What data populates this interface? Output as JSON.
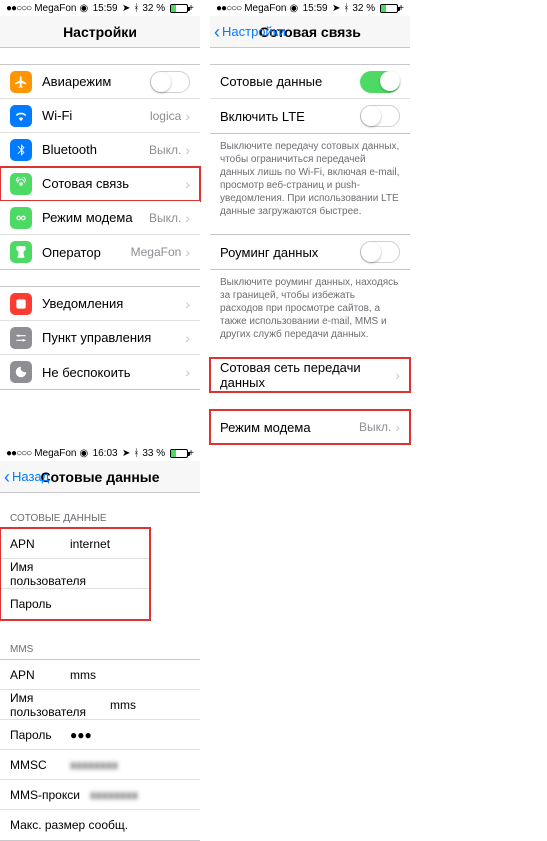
{
  "status": {
    "carrier": "MegaFon",
    "dots": "●●○○○",
    "wifi": "◉",
    "time1": "15:59",
    "time2": "15:59",
    "time3": "16:03",
    "battery1": "32 %",
    "battery2": "32 %",
    "battery3": "33 %"
  },
  "screen1": {
    "title": "Настройки",
    "rows": {
      "airplane": "Авиарежим",
      "wifi": "Wi-Fi",
      "wifi_val": "logica",
      "bt": "Bluetooth",
      "bt_val": "Выкл.",
      "cellular": "Сотовая связь",
      "hotspot": "Режим модема",
      "hotspot_val": "Выкл.",
      "carrier": "Оператор",
      "carrier_val": "MegaFon",
      "notif": "Уведомления",
      "control": "Пункт управления",
      "dnd": "Не беспокоить"
    }
  },
  "screen2": {
    "back": "Настройки",
    "title": "Сотовая связь",
    "cell_data": "Сотовые данные",
    "lte": "Включить LTE",
    "note1": "Выключите передачу сотовых данных, чтобы ограничиться передачей данных лишь по Wi-Fi, включая e-mail, просмотр веб-страниц и push-уведомления. При использовании LTE данные загружаются быстрее.",
    "roaming": "Роуминг данных",
    "note2": "Выключите роуминг данных, находясь за границей, чтобы избежать расходов при просмотре сайтов, а также использовании e-mail, MMS и других служб передачи данных.",
    "apn_settings": "Сотовая сеть передачи данных",
    "hotspot": "Режим модема",
    "hotspot_val": "Выкл."
  },
  "screen3": {
    "back": "Назад",
    "title": "Сотовые данные",
    "sect_cell": "СОТОВЫЕ ДАННЫЕ",
    "sect_mms": "MMS",
    "cell": {
      "apn_l": "APN",
      "apn_v": "internet",
      "user_l": "Имя пользователя",
      "user_v": "",
      "pass_l": "Пароль",
      "pass_v": ""
    },
    "mms": {
      "apn_l": "APN",
      "apn_v": "mms",
      "user_l": "Имя пользователя",
      "user_v": "mms",
      "pass_l": "Пароль",
      "pass_v": "●●●",
      "mmsc_l": "MMSC",
      "mmsc_v": "xxxxxxxx",
      "proxy_l": "MMS-прокси",
      "proxy_v": "xxxxxxxx",
      "size_l": "Макс. размер сообщ.",
      "size_v": ""
    }
  },
  "icons": {
    "airplane_c": "#ff9500",
    "wifi_c": "#007aff",
    "bt_c": "#007aff",
    "cell_c": "#4cd964",
    "hotspot_c": "#4cd964",
    "carrier_c": "#4cd964",
    "notif_c": "#8e8e93",
    "control_c": "#8e8e93",
    "dnd_c": "#8e8e93"
  }
}
